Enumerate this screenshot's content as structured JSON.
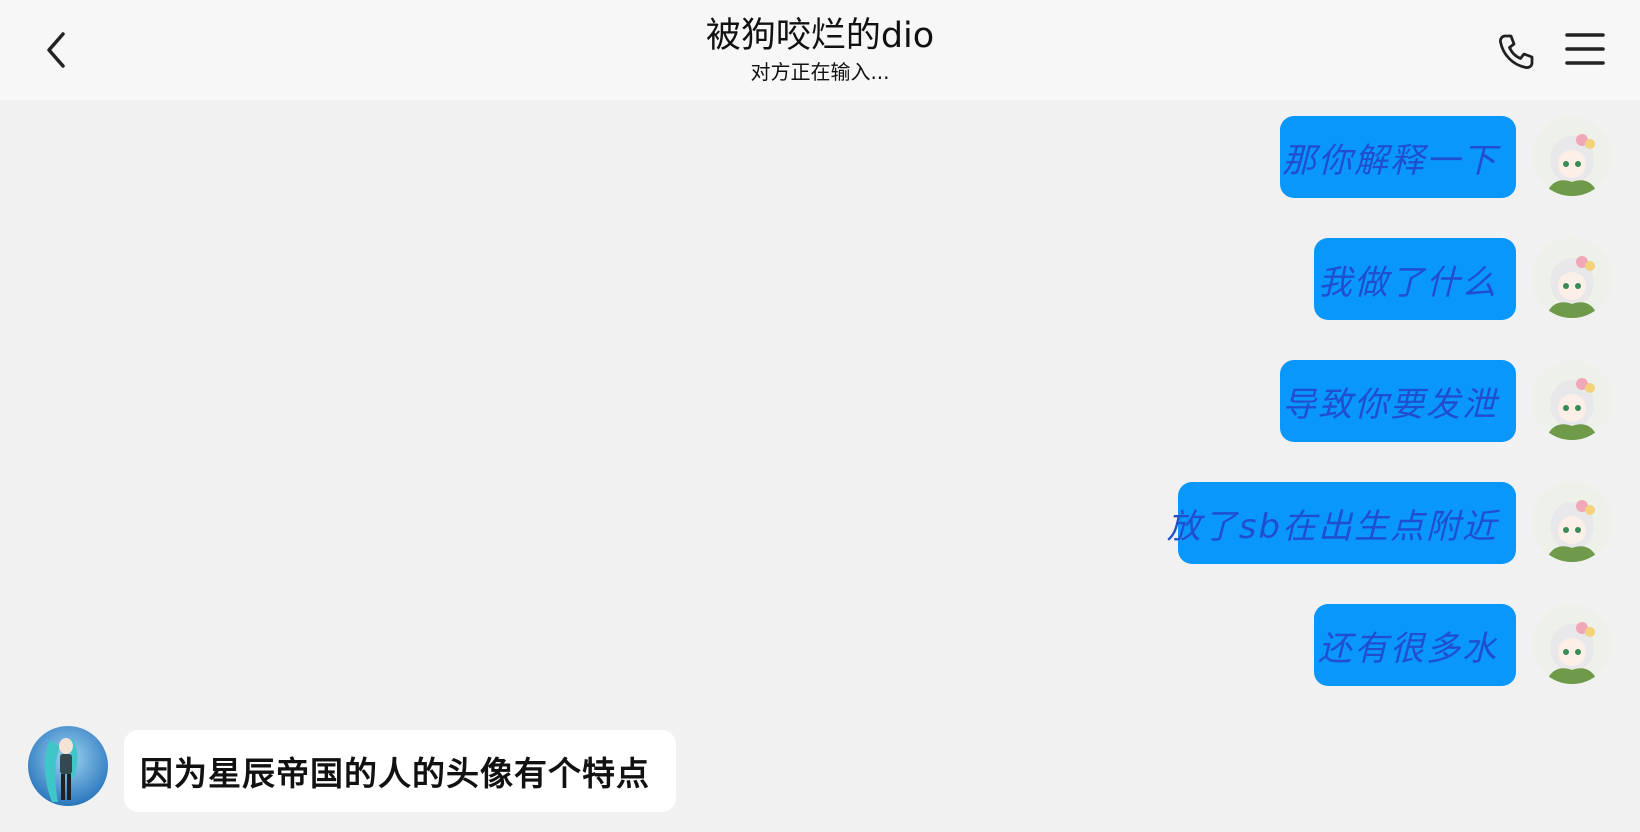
{
  "header": {
    "title": "被狗咬烂的dio",
    "status": "对方正在输入..."
  },
  "icons": {
    "back": "chevron-left-icon",
    "call": "phone-icon",
    "menu": "hamburger-menu-icon"
  },
  "colors": {
    "outgoing_bubble": "#0a97fb",
    "outgoing_text": "#1f4fcf",
    "incoming_bubble": "#ffffff",
    "background": "#f1f1f1"
  },
  "messages": [
    {
      "side": "outgoing",
      "text": "那你解释一下"
    },
    {
      "side": "outgoing",
      "text": "我做了什么"
    },
    {
      "side": "outgoing",
      "text": "导致你要发泄"
    },
    {
      "side": "outgoing",
      "text": "放了sb在出生点附近"
    },
    {
      "side": "outgoing",
      "text": "还有很多水"
    },
    {
      "side": "incoming",
      "text": "因为星辰帝国的人的头像有个特点"
    }
  ]
}
